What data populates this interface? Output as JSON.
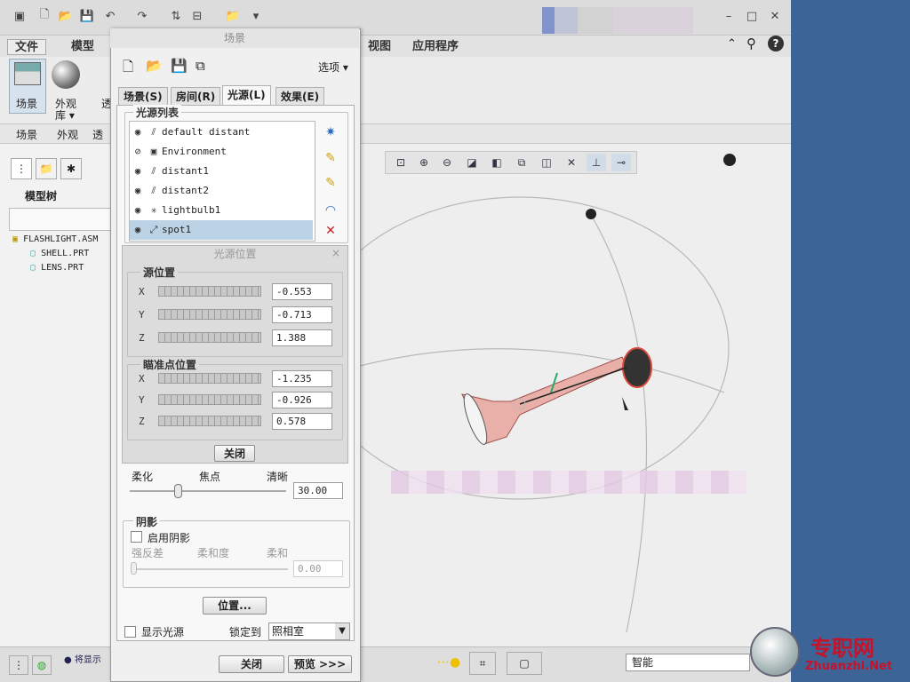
{
  "colors": {
    "accent": "#3c6496",
    "selection": "#bcd3e6",
    "spot": "#d84a3a"
  },
  "ribbon_tabs": {
    "file": "文件",
    "model": "模型",
    "view": "视图",
    "apps": "应用程序"
  },
  "ribbon": {
    "scene_label": "场景",
    "appearance_label": "外观",
    "appearance_lib": "库",
    "appearance_group": "外观",
    "scene_group": "场景",
    "trans_partial": "透"
  },
  "model_tree": {
    "title": "模型树",
    "root": "FLASHLIGHT.ASM",
    "children": [
      "SHELL.PRT",
      "LENS.PRT"
    ]
  },
  "dialog": {
    "title": "场景",
    "options_label": "选项",
    "tabs": [
      "场景(S)",
      "房间(R)",
      "光源(L)",
      "效果(E)"
    ],
    "light_list_legend": "光源列表",
    "lights": [
      "default distant",
      "Environment",
      "distant1",
      "distant2",
      "lightbulb1",
      "spot1"
    ],
    "soft_label": "柔化",
    "focus_label": "焦点",
    "sharp_label": "清晰",
    "sharpness_value": "30.00",
    "shadow_legend": "阴影",
    "enable_shadow": "启用阴影",
    "shadow_strength": "强反差",
    "shadow_softness": "柔和度",
    "shadow_soft": "柔和",
    "shadow_value": "0.00",
    "position_btn": "位置...",
    "show_lights": "显示光源",
    "lock_to": "锁定到",
    "lock_value": "照相室",
    "close_btn": "关闭",
    "preview_btn": "预览 >>>"
  },
  "light_pos": {
    "title": "光源位置",
    "source_legend": "源位置",
    "aim_legend": "瞄准点位置",
    "axes": [
      "X",
      "Y",
      "Z"
    ],
    "source": [
      "-0.553",
      "-0.713",
      "1.388"
    ],
    "aim": [
      "-1.235",
      "-0.926",
      "0.578"
    ],
    "close_btn": "关闭"
  },
  "status": {
    "message": "将显示",
    "smart": "智能"
  },
  "watermark": {
    "cn": "专职网",
    "url": "Zhuanzhi.Net"
  }
}
